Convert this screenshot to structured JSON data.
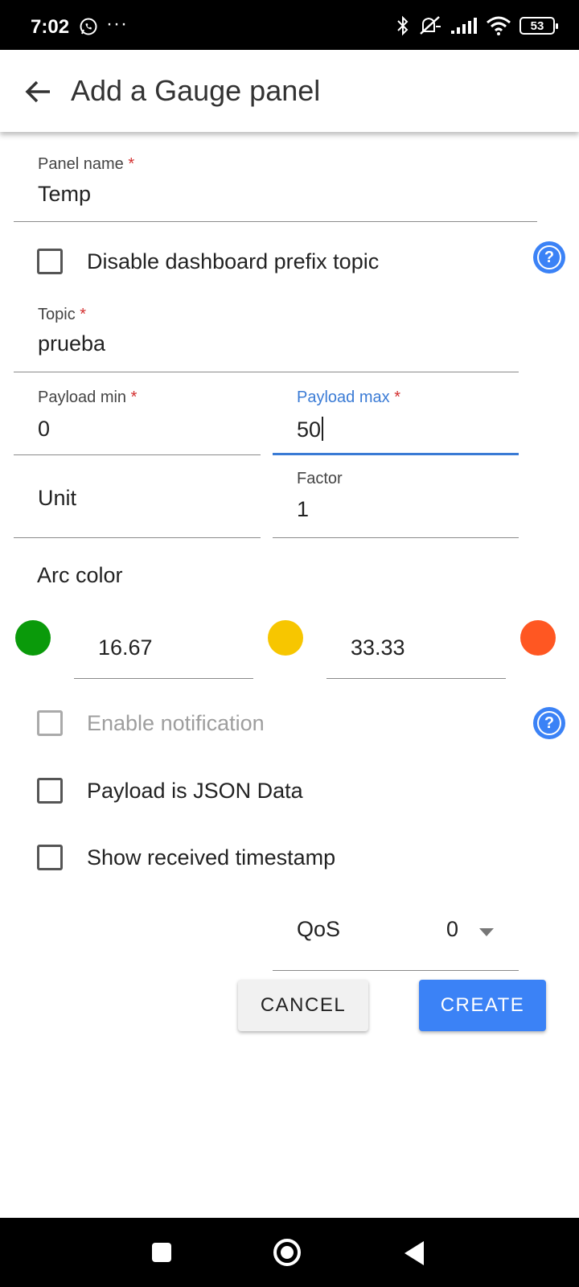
{
  "status_bar": {
    "time": "7:02",
    "more": "···",
    "battery": "53",
    "icons": [
      "whatsapp-icon",
      "bluetooth-icon",
      "mute-icon",
      "signal-icon",
      "wifi-icon",
      "battery-icon"
    ]
  },
  "app_bar": {
    "title": "Add a Gauge panel",
    "back_icon": "arrow-left-icon"
  },
  "form": {
    "panel_name": {
      "label": "Panel name",
      "required": "*",
      "value": "Temp"
    },
    "disable_prefix": {
      "label": "Disable dashboard prefix topic",
      "checked": false
    },
    "topic": {
      "label": "Topic",
      "required": "*",
      "value": "prueba"
    },
    "payload_min": {
      "label": "Payload min",
      "required": "*",
      "value": "0"
    },
    "payload_max": {
      "label": "Payload max",
      "required": "*",
      "value": "50"
    },
    "unit": {
      "label": "Unit",
      "value": ""
    },
    "factor": {
      "label": "Factor",
      "value": "1"
    },
    "arc_color": {
      "label": "Arc color",
      "colors": [
        "#0a9a0a",
        "#f7c600",
        "#ff5722"
      ],
      "thresholds": [
        "16.67",
        "33.33"
      ]
    },
    "enable_notification": {
      "label": "Enable notification",
      "checked": false,
      "disabled": true
    },
    "payload_json": {
      "label": "Payload is JSON Data",
      "checked": false
    },
    "show_timestamp": {
      "label": "Show received timestamp",
      "checked": false
    },
    "qos": {
      "label": "QoS",
      "value": "0"
    }
  },
  "buttons": {
    "cancel": "CANCEL",
    "create": "CREATE"
  },
  "colors": {
    "accent": "#3b82f6",
    "focus": "#3a7bd5",
    "required": "#d32f2f"
  }
}
